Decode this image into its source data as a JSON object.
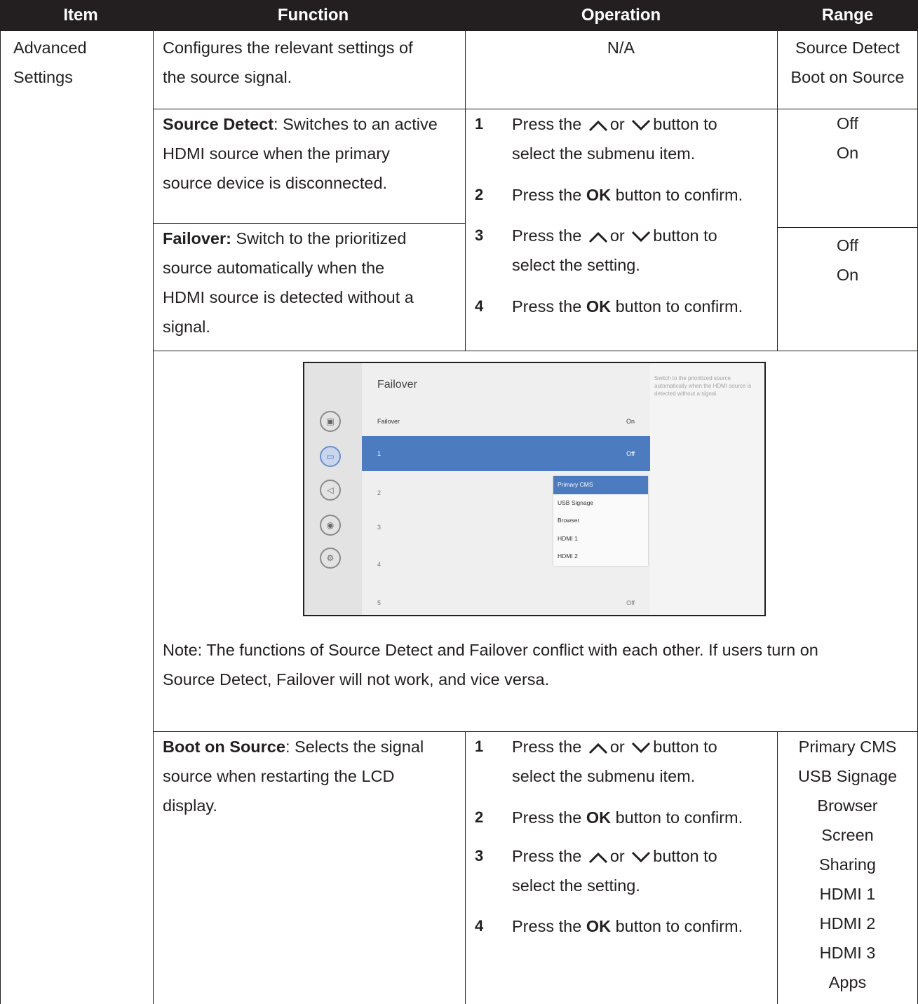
{
  "header": {
    "item": "Item",
    "function": "Function",
    "operation": "Operation",
    "range": "Range"
  },
  "item_cell": {
    "line1": "Advanced",
    "line2": "Settings"
  },
  "row1": {
    "function_line1": "Configures the relevant settings of",
    "function_line2": "the source signal.",
    "operation": "N/A",
    "range": [
      "Source Detect",
      "Boot on Source"
    ]
  },
  "source_detect": {
    "bold": "Source Detect",
    "line1_rest": ": Switches to an active",
    "line2": "HDMI source when the primary",
    "line3": "source device is disconnected.",
    "range": [
      "Off",
      "On"
    ]
  },
  "failover": {
    "bold": "Failover:",
    "line1_rest": " Switch to the prioritized",
    "line2": "source automatically when the",
    "line3": "HDMI source is detected without a",
    "line4": "signal.",
    "range": [
      "Off",
      "On"
    ]
  },
  "steps": {
    "s1_num": "1",
    "s1_a": "Press the",
    "s1_or": "or",
    "s1_b": "button to",
    "s1_c": "select the submenu item.",
    "s2_num": "2",
    "s2_a": "Press the",
    "s2_ok": "OK",
    "s2_b": "button to confirm.",
    "s3_num": "3",
    "s3_a": "Press the",
    "s3_or": "or",
    "s3_b": "button to",
    "s3_c": "select the setting.",
    "s4_num": "4",
    "s4_a": "Press the",
    "s4_ok": "OK",
    "s4_b": "button to confirm."
  },
  "screenshot": {
    "title": "Failover",
    "description": "Switch to the prioritized source automatically when the HDMI source is detected without a signal.",
    "rows": [
      {
        "label": "Failover",
        "value": "On"
      },
      {
        "label": "1",
        "value": "Off"
      },
      {
        "label": "2",
        "value": ""
      },
      {
        "label": "3",
        "value": ""
      },
      {
        "label": "4",
        "value": ""
      },
      {
        "label": "5",
        "value": "Off"
      }
    ],
    "dropdown": [
      "Primary CMS",
      "USB Signage",
      "Browser",
      "HDMI 1",
      "HDMI 2"
    ],
    "icons": [
      "picture-icon",
      "source-icon",
      "audio-icon",
      "network-icon",
      "settings-icon"
    ],
    "accent": "#4d7bc0"
  },
  "note": {
    "line1": "Note: The functions of Source Detect and Failover conflict with each other. If users turn on",
    "line2": "Source Detect, Failover will not work, and vice versa."
  },
  "boot_on_source": {
    "bold": "Boot on Source",
    "line1_rest": ": Selects the signal",
    "line2": "source when restarting the LCD",
    "line3": "display.",
    "range": [
      "Primary CMS",
      "USB Signage",
      "Browser",
      "Screen",
      "Sharing",
      "HDMI 1",
      "HDMI 2",
      "HDMI 3",
      "Apps"
    ]
  },
  "colors": {
    "header_bg": "#231f20",
    "header_text": "#ffffff"
  }
}
